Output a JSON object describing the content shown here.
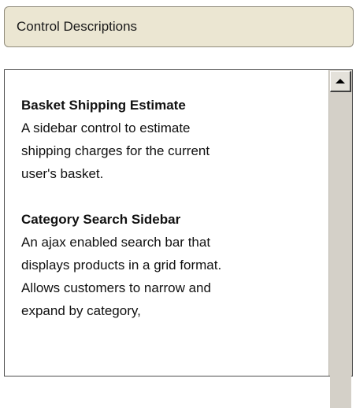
{
  "header": {
    "title": "Control Descriptions"
  },
  "controls": [
    {
      "title": "Basket Shipping Estimate",
      "description_lines": [
        "A sidebar control to estimate",
        "shipping charges for the current",
        "user's basket."
      ]
    },
    {
      "title": "Category Search Sidebar",
      "description_lines": [
        "An ajax enabled search bar that",
        "displays products in a grid format.",
        "Allows customers to narrow and",
        "expand by category,"
      ]
    }
  ],
  "scrollbar": {
    "up_icon": "up-arrow-icon"
  }
}
